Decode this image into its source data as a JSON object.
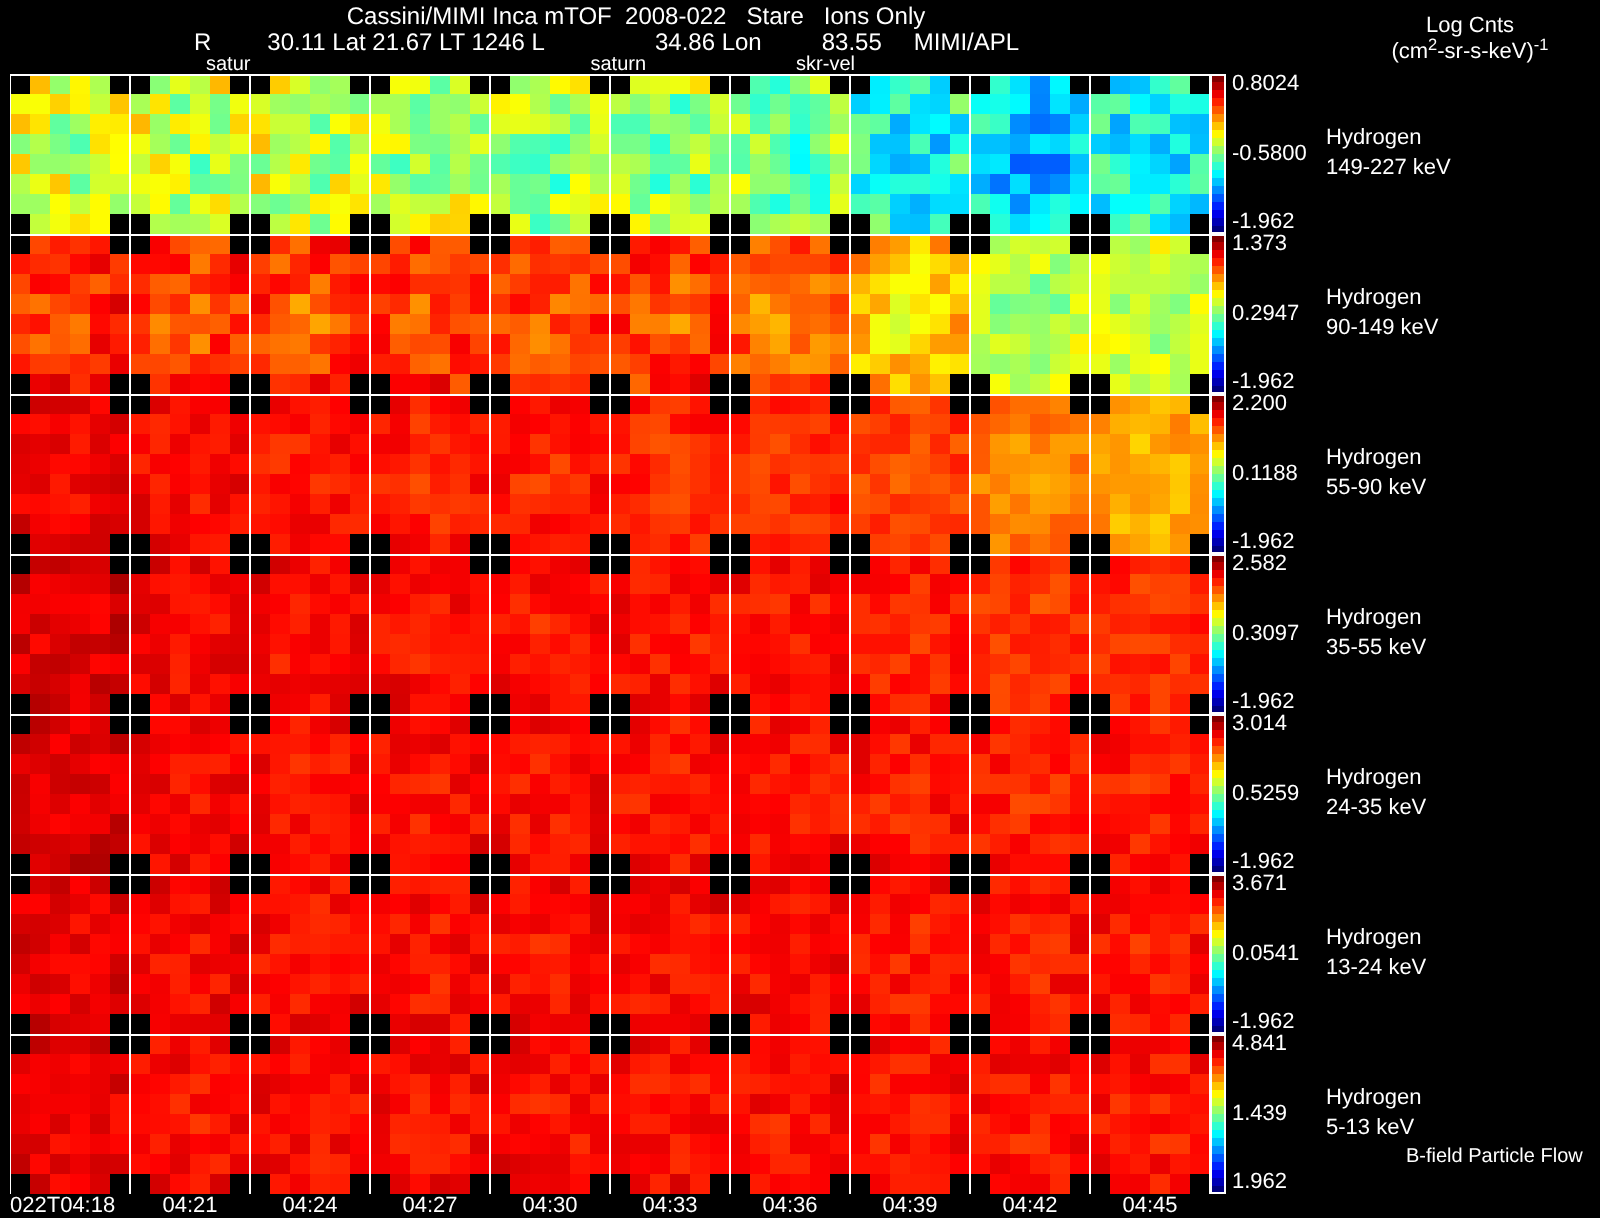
{
  "title": "Cassini/MIMI Inca mTOF  2008-022   Stare   Ions Only",
  "position_line": [
    "R",
    "30.11 Lat 21.67 LT 1246 L",
    "34.86 Lon",
    "83.55",
    "MIMI/APL"
  ],
  "annotations": [
    "satur",
    "saturn",
    "skr-vel"
  ],
  "legend": {
    "title": "Log Cnts",
    "units": "(cm$^{2}$-sr-s-keV)$^{-1}$"
  },
  "rows": [
    {
      "species": "Hydrogen",
      "energy": "149-227 keV",
      "max": "0.8024",
      "mid": "-0.5800",
      "min": "-1.962"
    },
    {
      "species": "Hydrogen",
      "energy": "90-149 keV",
      "max": "1.373",
      "mid": "0.2947",
      "min": "-1.962"
    },
    {
      "species": "Hydrogen",
      "energy": "55-90 keV",
      "max": "2.200",
      "mid": "0.1188",
      "min": "-1.962"
    },
    {
      "species": "Hydrogen",
      "energy": "35-55 keV",
      "max": "2.582",
      "mid": "0.3097",
      "min": "-1.962"
    },
    {
      "species": "Hydrogen",
      "energy": "24-35 keV",
      "max": "3.014",
      "mid": "0.5259",
      "min": "-1.962"
    },
    {
      "species": "Hydrogen",
      "energy": "13-24 keV",
      "max": "3.671",
      "mid": "0.0541",
      "min": "-1.962"
    },
    {
      "species": "Hydrogen",
      "energy": "5-13 keV",
      "max": "4.841",
      "mid": "1.439",
      "min": "1.962"
    }
  ],
  "footer_note": "B-field Particle Flow",
  "time_ticks": [
    "022T04:18",
    "04:21",
    "04:24",
    "04:27",
    "04:30",
    "04:33",
    "04:36",
    "04:39",
    "04:42",
    "04:45"
  ]
}
